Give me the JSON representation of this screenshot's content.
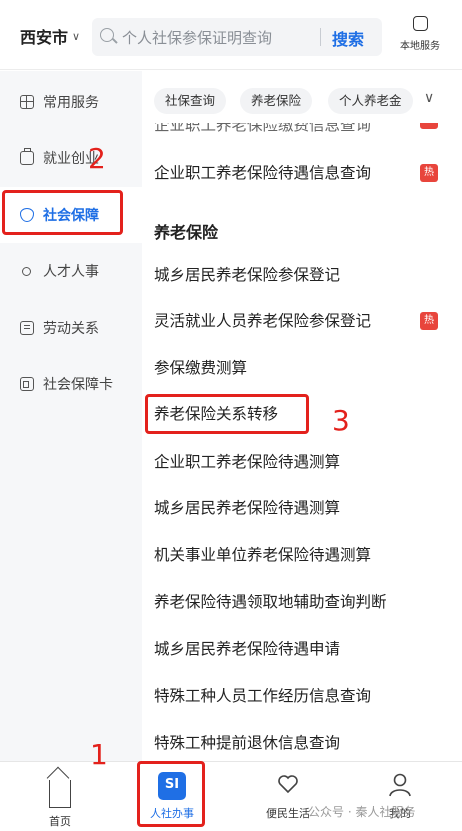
{
  "header": {
    "city": "西安市",
    "search_placeholder": "个人社保参保证明查询",
    "search_button": "搜索",
    "local_service": "本地服务"
  },
  "sidebar": {
    "items": [
      {
        "label": "常用服务",
        "icon": "grid-icon"
      },
      {
        "label": "就业创业",
        "icon": "briefcase-icon"
      },
      {
        "label": "社会保障",
        "icon": "shield-icon",
        "active": true
      },
      {
        "label": "人才人事",
        "icon": "person-icon"
      },
      {
        "label": "劳动关系",
        "icon": "document-icon"
      },
      {
        "label": "社会保障卡",
        "icon": "id-card-icon"
      }
    ]
  },
  "tags": [
    "社保查询",
    "养老保险",
    "个人养老金"
  ],
  "list": {
    "cut_row": "企业职工养老保险缴费信息查询",
    "hot_badge": "热",
    "rows": [
      {
        "label": "企业职工养老保险待遇信息查询",
        "hot": true
      },
      {
        "label": "养老保险",
        "section": true
      },
      {
        "label": "城乡居民养老保险参保登记"
      },
      {
        "label": "灵活就业人员养老保险参保登记",
        "hot": true
      },
      {
        "label": "参保缴费测算"
      },
      {
        "label": "养老保险关系转移"
      },
      {
        "label": "企业职工养老保险待遇测算"
      },
      {
        "label": "城乡居民养老保险待遇测算"
      },
      {
        "label": "机关事业单位养老保险待遇测算"
      },
      {
        "label": "养老保险待遇领取地辅助查询判断"
      },
      {
        "label": "城乡居民养老保险待遇申请"
      },
      {
        "label": "特殊工种人员工作经历信息查询"
      },
      {
        "label": "特殊工种提前退休信息查询"
      }
    ]
  },
  "bottom_nav": [
    {
      "label": "首页",
      "icon": "home-icon"
    },
    {
      "label": "人社办事",
      "icon": "si-icon",
      "icon_text": "SI",
      "active": true
    },
    {
      "label": "便民生活",
      "icon": "heart-hand-icon"
    },
    {
      "label": "我的",
      "icon": "person-icon"
    }
  ],
  "annotations": [
    "1",
    "2",
    "3"
  ],
  "watermark": "公众号 · 秦人社服务",
  "colors": {
    "accent": "#1f6fe5",
    "annotation": "#e3211c",
    "hot": "#e8453c"
  }
}
